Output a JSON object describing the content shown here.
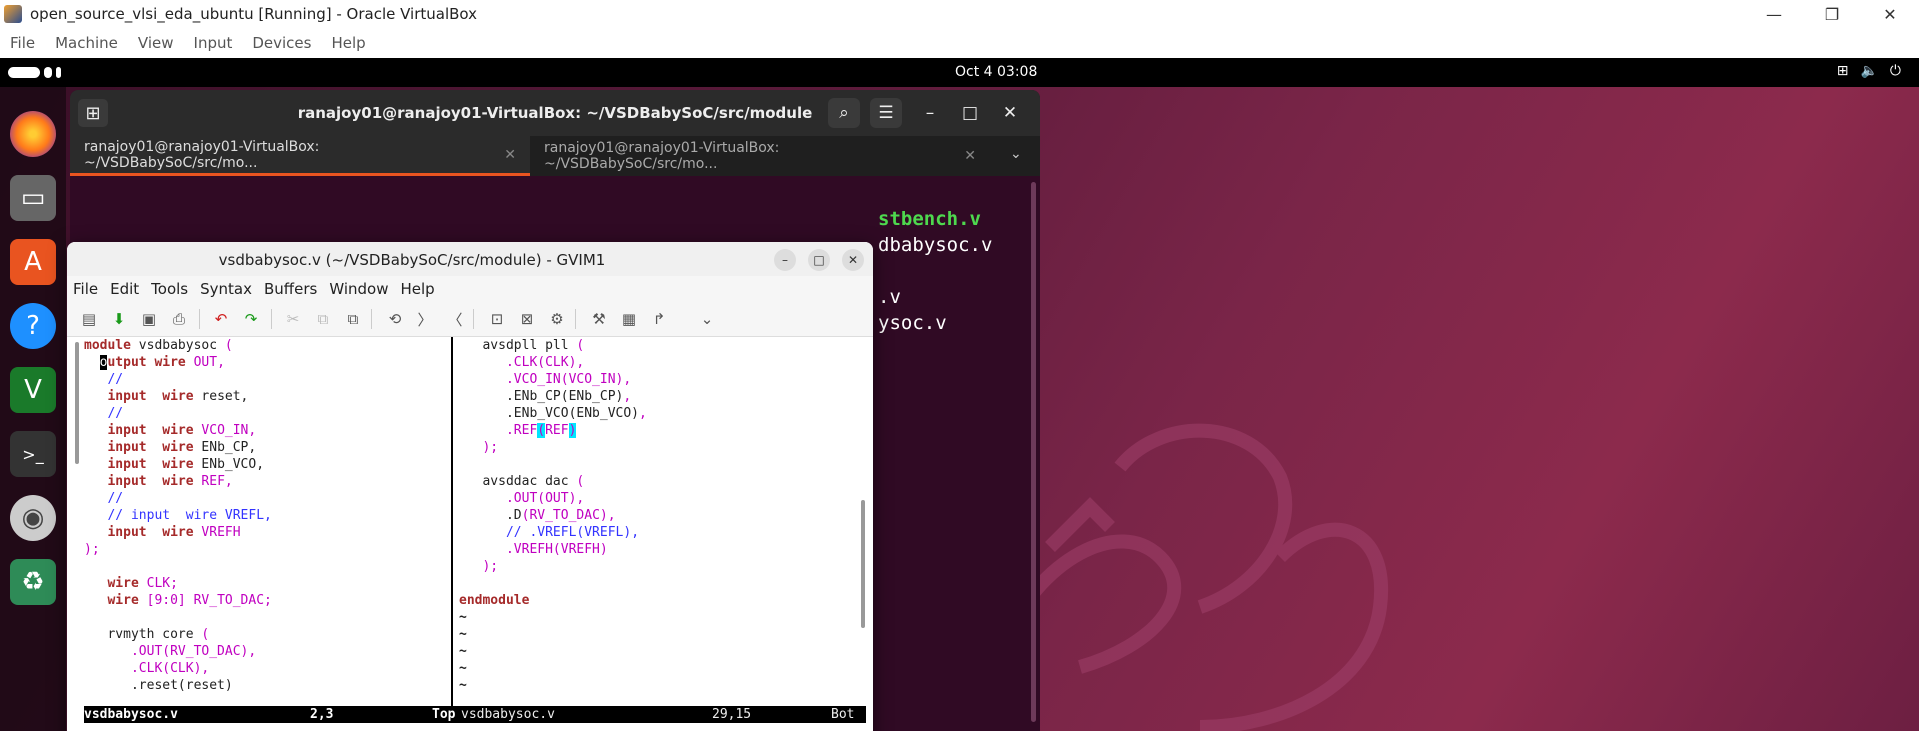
{
  "vbox": {
    "title": "open_source_vlsi_eda_ubuntu [Running] - Oracle VirtualBox",
    "menu": [
      "File",
      "Machine",
      "View",
      "Input",
      "Devices",
      "Help"
    ],
    "min": "—",
    "max": "❐",
    "close": "✕"
  },
  "topbar": {
    "clock": "Oct 4  03:08"
  },
  "terminal": {
    "title": "ranajoy01@ranajoy01-VirtualBox: ~/VSDBabySoC/src/module",
    "tab1": "ranajoy01@ranajoy01-VirtualBox: ~/VSDBabySoC/src/mo...",
    "tab2": "ranajoy01@ranajoy01-VirtualBox: ~/VSDBabySoC/src/mo...",
    "out1": "stbench.v",
    "out2": "dbabysoc.v",
    "out3": ".v",
    "out4": "ysoc.v"
  },
  "gvim": {
    "title": "vsdbabysoc.v (~/VSDBabySoC/src/module) - GVIM1",
    "menu": [
      "File",
      "Edit",
      "Tools",
      "Syntax",
      "Buffers",
      "Window",
      "Help"
    ],
    "status_left_file": "vsdbabysoc.v",
    "status_left_pos": "2,3",
    "status_left_pct": "Top",
    "status_right_file": "vsdbabysoc.v",
    "status_right_pos": "29,15",
    "status_right_pct": "Bot"
  },
  "colors": {
    "ubuntu_orange": "#e95420",
    "vim_keyword": "#a52a2a",
    "vim_magenta": "#c000c0"
  }
}
